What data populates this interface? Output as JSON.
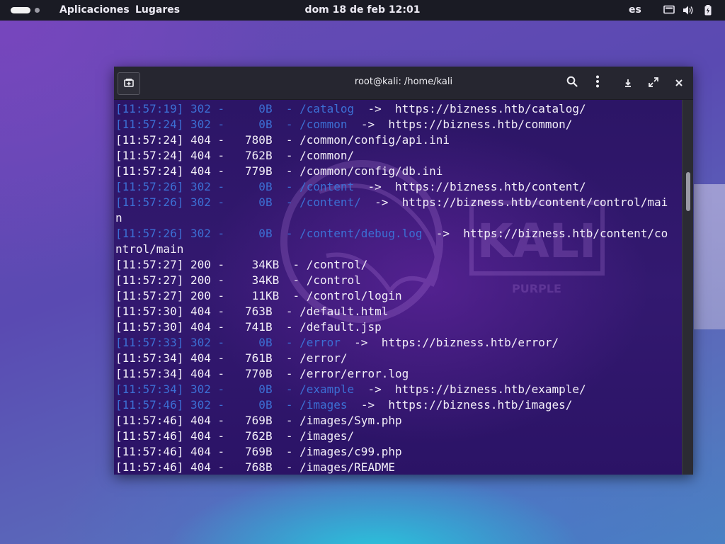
{
  "topbar": {
    "menu_apps": "Aplicaciones",
    "menu_places": "Lugares",
    "clock": "dom 18 de feb  12:01",
    "lang": "es"
  },
  "terminal": {
    "title": "root@kali: /home/kali",
    "watermark_text": "KALI",
    "watermark_sub": "PURPLE",
    "lines": [
      {
        "t": "[11:57:19]",
        "code": "302",
        "size": "   0B",
        "path": "/catalog  ",
        "arrow": "->",
        "url": "https://bizness.htb/catalog/"
      },
      {
        "t": "[11:57:24]",
        "code": "302",
        "size": "   0B",
        "path": "/common  ",
        "arrow": "->",
        "url": "https://bizness.htb/common/"
      },
      {
        "t": "[11:57:24]",
        "code": "404",
        "size": " 780B",
        "path": "/common/config/api.ini"
      },
      {
        "t": "[11:57:24]",
        "code": "404",
        "size": " 762B",
        "path": "/common/"
      },
      {
        "t": "[11:57:24]",
        "code": "404",
        "size": " 779B",
        "path": "/common/config/db.ini"
      },
      {
        "t": "[11:57:26]",
        "code": "302",
        "size": "   0B",
        "path": "/content  ",
        "arrow": "->",
        "url": "https://bizness.htb/content/"
      },
      {
        "t": "[11:57:26]",
        "code": "302",
        "size": "   0B",
        "path": "/content/  ",
        "arrow": "->",
        "url": "https://bizness.htb/content/control/mai"
      },
      {
        "wrap": "n"
      },
      {
        "t": "[11:57:26]",
        "code": "302",
        "size": "   0B",
        "path": "/content/debug.log  ",
        "arrow": "->",
        "url": "https://bizness.htb/content/co"
      },
      {
        "wrap": "ntrol/main"
      },
      {
        "t": "[11:57:27]",
        "code": "200",
        "size": "  34KB",
        "path": "/control/"
      },
      {
        "t": "[11:57:27]",
        "code": "200",
        "size": "  34KB",
        "path": "/control"
      },
      {
        "t": "[11:57:27]",
        "code": "200",
        "size": "  11KB",
        "path": "/control/login"
      },
      {
        "t": "[11:57:30]",
        "code": "404",
        "size": " 763B",
        "path": "/default.html"
      },
      {
        "t": "[11:57:30]",
        "code": "404",
        "size": " 741B",
        "path": "/default.jsp"
      },
      {
        "t": "[11:57:33]",
        "code": "302",
        "size": "   0B",
        "path": "/error  ",
        "arrow": "->",
        "url": "https://bizness.htb/error/"
      },
      {
        "t": "[11:57:34]",
        "code": "404",
        "size": " 761B",
        "path": "/error/"
      },
      {
        "t": "[11:57:34]",
        "code": "404",
        "size": " 770B",
        "path": "/error/error.log"
      },
      {
        "t": "[11:57:34]",
        "code": "302",
        "size": "   0B",
        "path": "/example  ",
        "arrow": "->",
        "url": "https://bizness.htb/example/"
      },
      {
        "t": "[11:57:46]",
        "code": "302",
        "size": "   0B",
        "path": "/images  ",
        "arrow": "->",
        "url": "https://bizness.htb/images/"
      },
      {
        "t": "[11:57:46]",
        "code": "404",
        "size": " 769B",
        "path": "/images/Sym.php"
      },
      {
        "t": "[11:57:46]",
        "code": "404",
        "size": " 762B",
        "path": "/images/"
      },
      {
        "t": "[11:57:46]",
        "code": "404",
        "size": " 769B",
        "path": "/images/c99.php"
      },
      {
        "t": "[11:57:46]",
        "code": "404",
        "size": " 768B",
        "path": "/images/README"
      }
    ]
  },
  "colors": {
    "redirect": "#3c6fd4",
    "text": "#f2eef8",
    "topbar": "#1a1b24",
    "titlebar": "#262630"
  },
  "icons": {
    "new_tab": "new-tab-icon",
    "search": "search-icon",
    "menu": "kebab-menu-icon",
    "download": "download-icon",
    "fullscreen": "fullscreen-icon",
    "close": "close-icon",
    "screen": "screen-icon",
    "volume": "volume-icon",
    "battery": "battery-icon"
  }
}
